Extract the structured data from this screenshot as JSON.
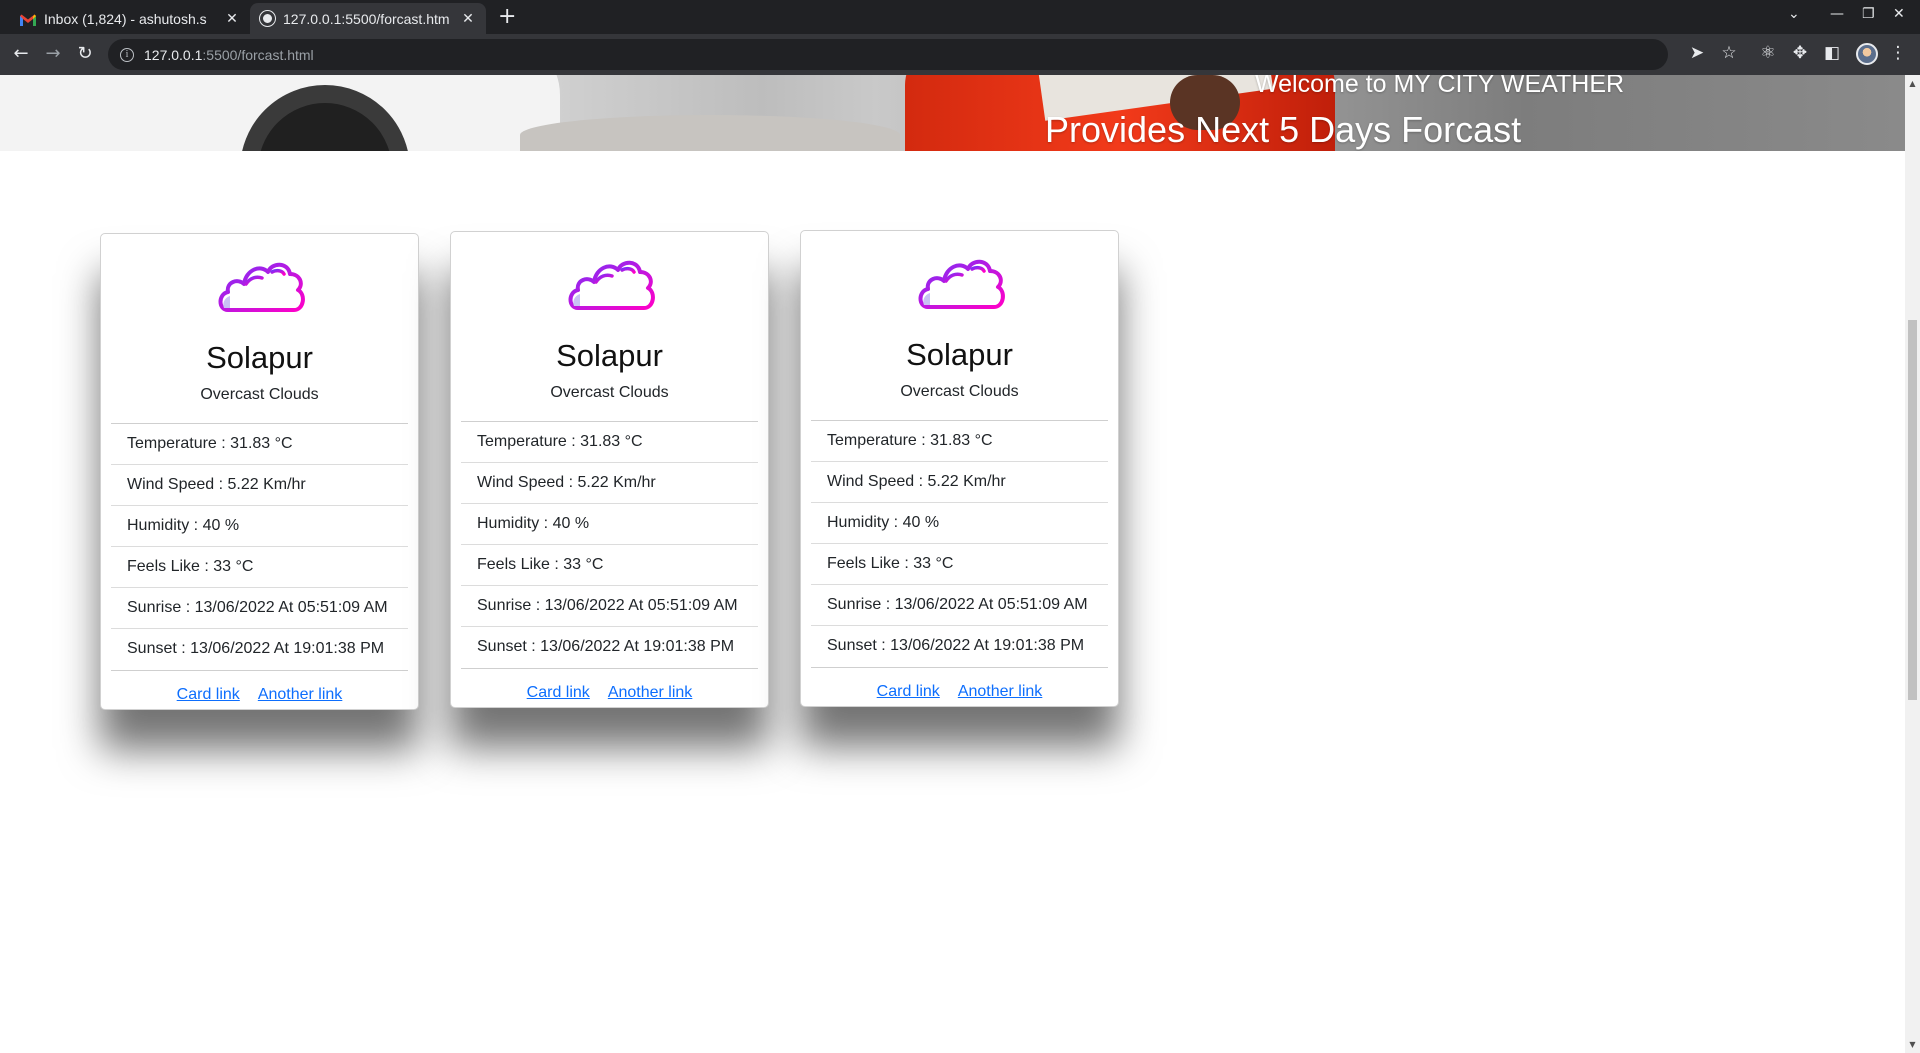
{
  "browser": {
    "tabs": [
      {
        "title": "Inbox (1,824) - ashutosh.s",
        "favicon": "gmail-icon",
        "active": false
      },
      {
        "title": "127.0.0.1:5500/forcast.htm",
        "favicon": "globe-icon",
        "active": true
      }
    ],
    "new_tab_label": "+",
    "url_host": "127.0.0.1",
    "url_path": ":5500/forcast.html"
  },
  "hero": {
    "welcome": "Welcome to MY CITY WEATHER",
    "title": "Provides Next 5 Days Forcast"
  },
  "cards": [
    {
      "city": "Solapur",
      "description": "Overcast Clouds",
      "items": [
        "Temperature : 31.83 °C",
        "Wind Speed : 5.22 Km/hr",
        "Humidity : 40 %",
        "Feels Like : 33 °C",
        "Sunrise : 13/06/2022 At 05:51:09 AM",
        "Sunset : 13/06/2022 At 19:01:38 PM"
      ],
      "links": [
        "Card link",
        "Another link"
      ]
    },
    {
      "city": "Solapur",
      "description": "Overcast Clouds",
      "items": [
        "Temperature : 31.83 °C",
        "Wind Speed : 5.22 Km/hr",
        "Humidity : 40 %",
        "Feels Like : 33 °C",
        "Sunrise : 13/06/2022 At 05:51:09 AM",
        "Sunset : 13/06/2022 At 19:01:38 PM"
      ],
      "links": [
        "Card link",
        "Another link"
      ]
    },
    {
      "city": "Solapur",
      "description": "Overcast Clouds",
      "items": [
        "Temperature : 31.83 °C",
        "Wind Speed : 5.22 Km/hr",
        "Humidity : 40 %",
        "Feels Like : 33 °C",
        "Sunrise : 13/06/2022 At 05:51:09 AM",
        "Sunset : 13/06/2022 At 19:01:38 PM"
      ],
      "links": [
        "Card link",
        "Another link"
      ]
    }
  ],
  "colors": {
    "link": "#0d6efd",
    "icon_gradient_start": "#7b2ff7",
    "icon_gradient_end": "#ff00c8"
  }
}
